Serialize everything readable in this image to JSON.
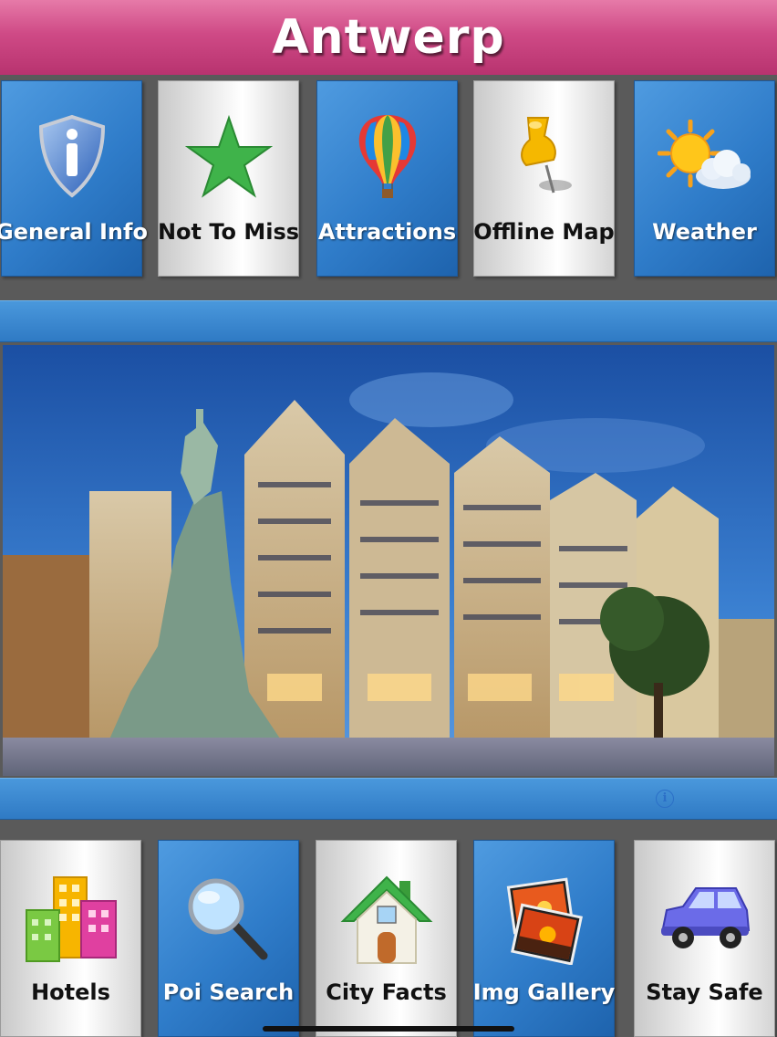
{
  "header": {
    "title": "Antwerp"
  },
  "top_menu": [
    {
      "label": "General Info",
      "icon": "info-shield-icon"
    },
    {
      "label": "Not To Miss",
      "icon": "star-icon"
    },
    {
      "label": "Attractions",
      "icon": "hot-air-balloon-icon"
    },
    {
      "label": "Offline Map",
      "icon": "pushpin-icon"
    },
    {
      "label": "Weather",
      "icon": "sun-cloud-icon"
    }
  ],
  "hero": {
    "subject": "grote-markt-photo"
  },
  "info_button": {
    "glyph": "i"
  },
  "bottom_menu": [
    {
      "label": "Hotels",
      "icon": "buildings-icon"
    },
    {
      "label": "Poi Search",
      "icon": "magnifier-icon"
    },
    {
      "label": "City Facts",
      "icon": "house-icon"
    },
    {
      "label": "Img Gallery",
      "icon": "photos-icon"
    },
    {
      "label": "Stay Safe",
      "icon": "car-icon"
    }
  ],
  "colors": {
    "header_pink": "#cf4a86",
    "tile_blue": "#2f7cc9",
    "tile_gray": "#eeeeee",
    "background": "#5a5a5a"
  }
}
